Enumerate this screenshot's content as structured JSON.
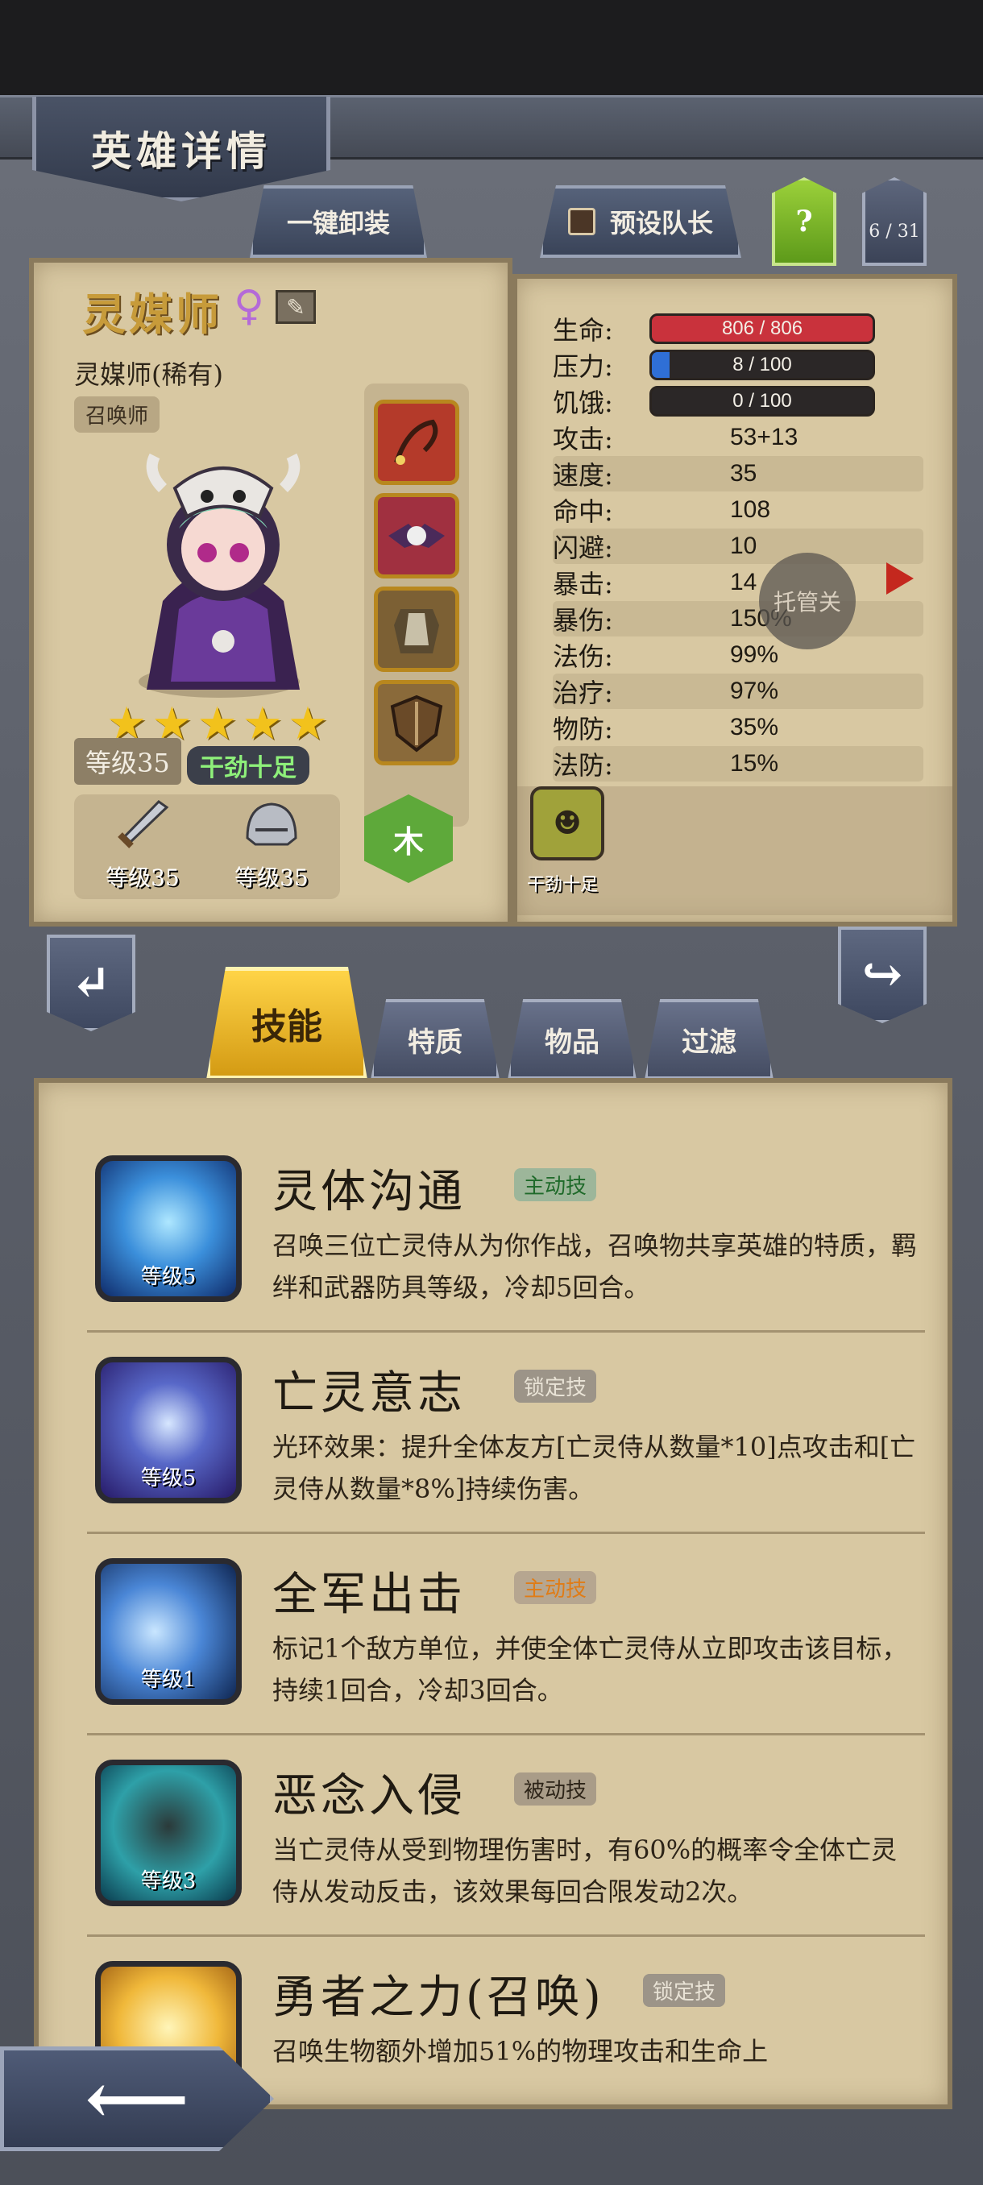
{
  "header": {
    "title": "英雄详情"
  },
  "toolbar": {
    "onekey_label": "一键卸装",
    "preset_leader_label": "预设队长",
    "help_label": "?",
    "roster_count": "6 / 31"
  },
  "hero": {
    "name": "灵媒师",
    "gender_icon": "female-icon",
    "subtitle": "灵媒师(稀有)",
    "class": "召唤师",
    "stars": [
      "★",
      "★",
      "★",
      "★",
      "★"
    ],
    "level": "等级35",
    "mood": "干劲十足",
    "element": "木",
    "weapon_level": "等级35",
    "armor_level": "等级35"
  },
  "stats": [
    {
      "label": "生命:",
      "value": "806 / 806",
      "fill": 1.0,
      "color": "#c9323c"
    },
    {
      "label": "压力:",
      "value": "8 / 100",
      "fill": 0.08,
      "color": "#2f6fd6"
    },
    {
      "label": "饥饿:",
      "value": "0 / 100",
      "fill": 0.0,
      "color": "#2b2727"
    },
    {
      "label": "攻击:",
      "value": "53+13"
    },
    {
      "label": "速度:",
      "value": "35"
    },
    {
      "label": "命中:",
      "value": "108"
    },
    {
      "label": "闪避:",
      "value": "10"
    },
    {
      "label": "暴击:",
      "value": "14"
    },
    {
      "label": "暴伤:",
      "value": "150%"
    },
    {
      "label": "法伤:",
      "value": "99%"
    },
    {
      "label": "治疗:",
      "value": "97%"
    },
    {
      "label": "物防:",
      "value": "35%"
    },
    {
      "label": "法防:",
      "value": "15%"
    }
  ],
  "auto_button": "托管关",
  "trait": {
    "label": "干劲十足"
  },
  "tabs": {
    "skill": "技能",
    "trait": "特质",
    "item": "物品",
    "filter": "过滤"
  },
  "skills": [
    {
      "name": "灵体沟通",
      "tag": "主动技",
      "level": "等级5",
      "desc": "召唤三位亡灵侍从为你作战，召唤物共享英雄的特质，羁绊和武器防具等级，冷却5回合。"
    },
    {
      "name": "亡灵意志",
      "tag": "锁定技",
      "level": "等级5",
      "desc": "光环效果：提升全体友方[亡灵侍从数量*10]点攻击和[亡灵侍从数量*8%]持续伤害。"
    },
    {
      "name": "全军出击",
      "tag": "主动技",
      "level": "等级1",
      "desc": "标记1个敌方单位，并使全体亡灵侍从立即攻击该目标，持续1回合，冷却3回合。"
    },
    {
      "name": "恶念入侵",
      "tag": "被动技",
      "level": "等级3",
      "desc": "当亡灵侍从受到物理伤害时，有60%的概率令全体亡灵侍从发动反击，该效果每回合限发动2次。"
    },
    {
      "name": "勇者之力(召唤)",
      "tag": "锁定技",
      "level": "",
      "desc": "召唤生物额外增加51%的物理攻击和生命上"
    }
  ],
  "colors": {
    "parchment": "#d8c8a2",
    "gold": "#c79b3a",
    "accent_green": "#5ea93a",
    "tab_active": "#ffd447"
  }
}
